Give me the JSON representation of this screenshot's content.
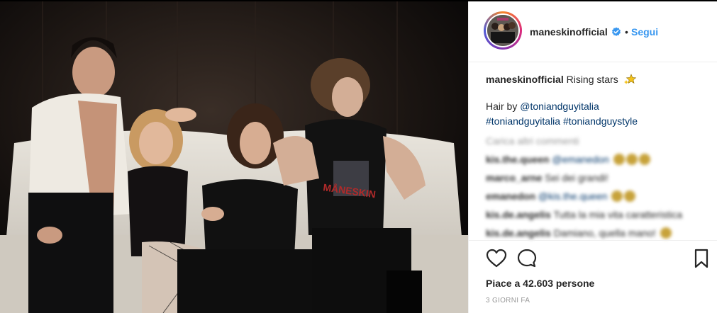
{
  "post": {
    "username": "maneskinofficial",
    "follow_separator": "•",
    "follow_label": "Segui",
    "caption_text": "Rising stars",
    "hair_prefix": "Hair by",
    "hair_mention": "@toniandguyitalia",
    "hashtag_1": "#toniandguyitalia",
    "hashtag_2": "#toniandguystyle",
    "load_more_label": "Carica altri commenti",
    "comments": [
      {
        "user": "kis.the.queen",
        "text": "",
        "mention": "@emanedon",
        "emoji_count": 3
      },
      {
        "user": "marco_arne",
        "text": "Sei dei grandi!",
        "mention": "",
        "emoji_count": 0
      },
      {
        "user": "emanedon",
        "text": "",
        "mention": "@kis.the.queen",
        "emoji_count": 2
      },
      {
        "user": "kis.de.angelis",
        "text": "Tutta la mia vita caratteristica",
        "mention": "",
        "emoji_count": 0
      },
      {
        "user": "kis.de.angelis",
        "text": "Damiano, quella mano!",
        "mention": "",
        "emoji_count": 1
      }
    ],
    "likes_prefix": "Piace a",
    "likes_count": "42.603",
    "likes_suffix": "persone",
    "timestamp": "3 giorni fa"
  },
  "icons": {
    "like": "heart-icon",
    "comment": "comment-icon",
    "save": "bookmark-icon",
    "verified": "verified-badge-icon",
    "caption_emoji": "sparkle-star-icon"
  },
  "colors": {
    "link_blue": "#3897f0",
    "mention_navy": "#003569",
    "muted_gray": "#999999",
    "text": "#262626"
  }
}
